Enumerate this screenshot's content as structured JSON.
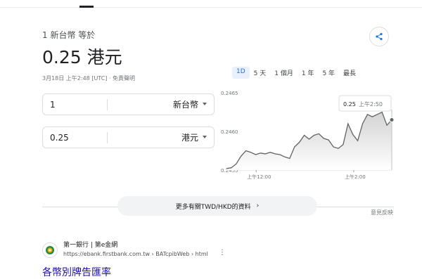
{
  "header": {
    "subtitle": "1 新台幣 等於",
    "result": "0.25 港元",
    "timestamp": "3月18日 上午2:48 [UTC] · 免責聲明"
  },
  "periods": [
    "1D",
    "5 天",
    "1 個月",
    "1 年",
    "5 年",
    "最長"
  ],
  "converter": {
    "from": {
      "value": "1",
      "unit": "新台幣"
    },
    "to": {
      "value": "0.25",
      "unit": "港元"
    }
  },
  "chart_data": {
    "type": "area",
    "y_ticks": [
      "0.2465",
      "0.2460",
      "0.2455"
    ],
    "x_ticks": [
      "上午12:00",
      "上午2:00"
    ],
    "ylim": [
      0.2455,
      0.2465
    ],
    "values": [
      0.24552,
      0.24553,
      0.24558,
      0.24568,
      0.24575,
      0.24573,
      0.2457,
      0.24572,
      0.24571,
      0.24573,
      0.24571,
      0.2457,
      0.24567,
      0.24565,
      0.2458,
      0.24586,
      0.24595,
      0.2459,
      0.24595,
      0.24597,
      0.24591,
      0.24589,
      0.2458,
      0.24578,
      0.24583,
      0.2461,
      0.24596,
      0.24588,
      0.2461,
      0.24622,
      0.24619,
      0.24622,
      0.24625,
      0.24608,
      0.24615
    ],
    "tooltip": {
      "value": "0.25",
      "time": "上午2:50"
    }
  },
  "more": {
    "label": "更多有關TWD/HKD的資料",
    "arrow": "›"
  },
  "feedback": "意見反映",
  "result": {
    "title": "第一銀行 | 第e金網",
    "url": "https://ebank.firstbank.com.tw › BATcpibWeb › html",
    "more_icon": "⋮",
    "link": "各幣別牌告匯率"
  }
}
